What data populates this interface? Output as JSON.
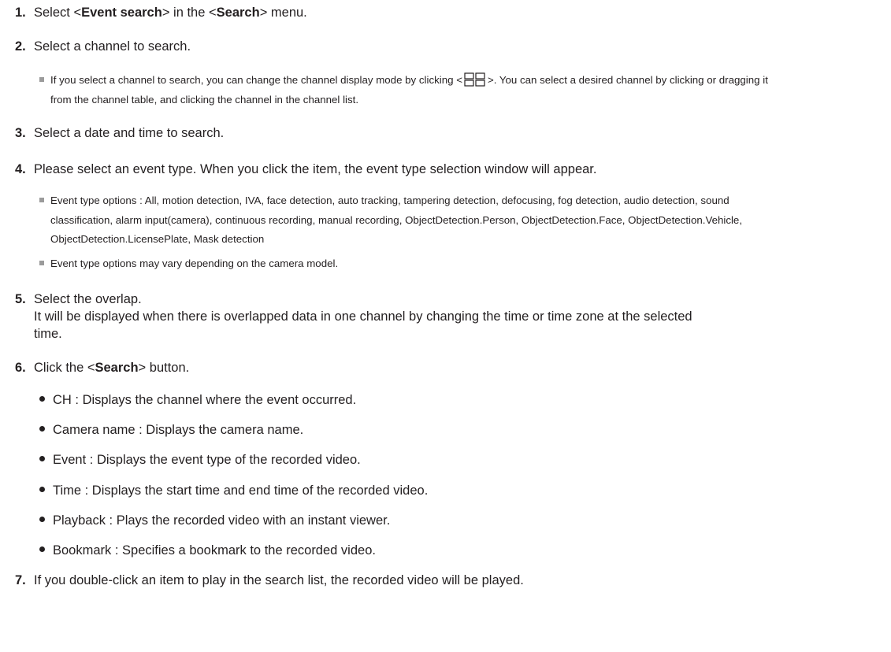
{
  "steps": {
    "s1": {
      "num": "1.",
      "pre": "Select <",
      "b1": "Event search",
      "mid": "> in the <",
      "b2": "Search",
      "post": "> menu."
    },
    "s2": {
      "num": "2.",
      "text": "Select a channel to search."
    },
    "s3": {
      "num": "3.",
      "text": "Select a date and time to search."
    },
    "s4": {
      "num": "4.",
      "text": "Please select an event type. When you click the item, the event type selection window will appear."
    },
    "s5": {
      "num": "5.",
      "text": "Select the overlap.",
      "cont1": "It will be displayed when there is overlapped data in one channel by changing the time or time zone at the selected",
      "cont2": "time."
    },
    "s6": {
      "num": "6.",
      "pre": "Click the <",
      "b": "Search",
      "post": "> button."
    },
    "s7": {
      "num": "7.",
      "text": "If you double-click an item to play in the search list, the recorded video will be played."
    }
  },
  "notes": {
    "n2a_pre": "If you select a channel to search, you can change the channel display mode by clicking <",
    "n2a_post": ">. You can select a desired channel by clicking or dragging it",
    "n2b": "from the channel table, and clicking the channel in the channel list.",
    "n4a1": "Event type options : All, motion detection, IVA, face detection, auto tracking, tampering detection, defocusing, fog detection, audio detection, sound",
    "n4a2": "classification, alarm input(camera), continuous recording, manual recording, ObjectDetection.Person, ObjectDetection.Face, ObjectDetection.Vehicle,",
    "n4a3": "ObjectDetection.LicensePlate, Mask detection",
    "n4b": "Event type options may vary depending on the camera model."
  },
  "bullets": [
    "CH : Displays the channel where the event occurred.",
    "Camera name : Displays the camera name.",
    "Event : Displays the event type of the recorded video.",
    "Time : Displays the start time and end time of the recorded video.",
    "Playback : Plays the recorded video with an instant viewer.",
    "Bookmark : Specifies a bookmark to the recorded video."
  ],
  "icons": {
    "display_mode": "grid-2x2-icon",
    "note_marker": "square-bullet",
    "list_marker": "round-bullet"
  }
}
